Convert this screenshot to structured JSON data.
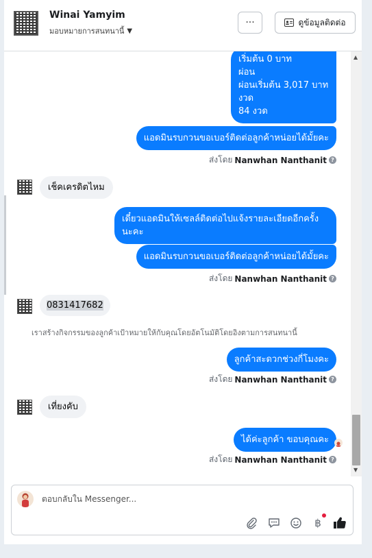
{
  "header": {
    "contact_name": "Winai Yamyim",
    "assign_label": "มอบหมายการสนทนานี้",
    "more_label": "···",
    "view_contact_label": "ดูข้อมูลติดต่อ"
  },
  "messages": {
    "m1_line1": "เริ่มต้น 0 บาท",
    "m1_line2": "ผ่อน",
    "m1_line3": "ผ่อนเริ่มต้น 3,017 บาท",
    "m1_line4": "งวด",
    "m1_line5": "84 งวด",
    "m2": "แอดมินรบกวนขอเบอร์ติดต่อลูกค้าหน่อยได้มั้ยคะ",
    "m3": "เช็คเครดิตไหม",
    "m4_line1": "เดี๋ยวแอดมินให้เซลล์ติดต่อไปแจ้งรายละเอียดอีกครั้ง",
    "m4_line2": "นะคะ",
    "m5": "แอดมินรบกวนขอเบอร์ติดต่อลูกค้าหน่อยได้มั้ยคะ",
    "m6": "0831417682",
    "system": "เราสร้างกิจกรรมของลูกค้าเป้าหมายให้กับคุณโดยอัตโนมัติโดยอิงตามการสนทนานี้",
    "m7": "ลูกค้าสะดวกช่วงกี่โมงคะ",
    "m8": "เที่ยงคับ",
    "m9": "ได้ค่ะลูกค้า ขอบคุณคะ"
  },
  "sender": {
    "prefix": "ส่งโดย",
    "name": "Nanwhan Nanthanit",
    "info_icon": "?"
  },
  "reply": {
    "placeholder": "ตอบกลับใน Messenger..."
  },
  "icons": {
    "attach": "paperclip-icon",
    "saved_reply": "chat-bubble-icon",
    "emoji": "smiley-icon",
    "payment": "baht-icon",
    "like": "thumbs-up-icon"
  },
  "colors": {
    "outgoing_bubble": "#0a7cff",
    "incoming_bubble": "#f0f2f5",
    "notify_dot": "#e41e3f"
  }
}
